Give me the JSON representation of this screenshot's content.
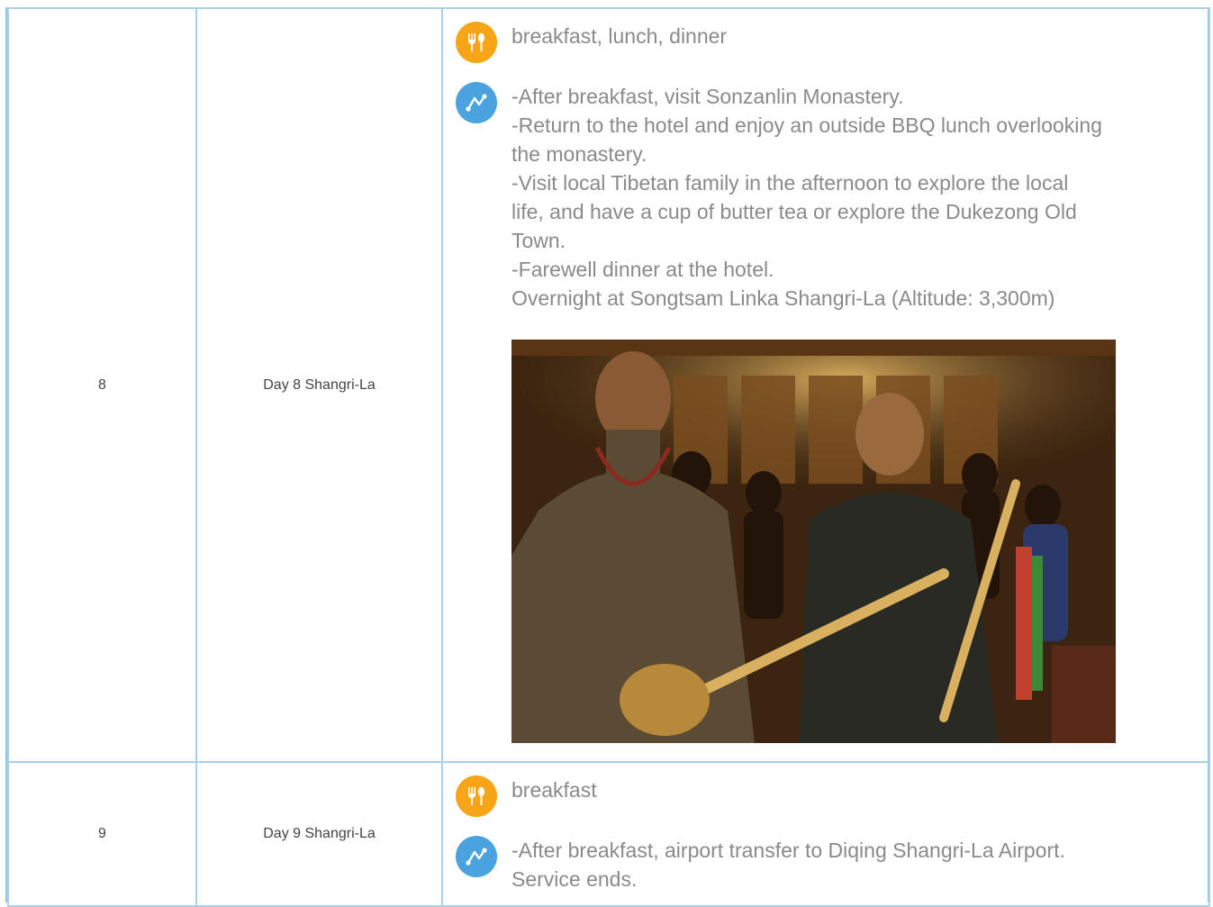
{
  "rows": [
    {
      "number": "8",
      "day": "Day 8 Shangri-La",
      "meals": "breakfast, lunch, dinner",
      "activities": [
        "-After breakfast, visit Sonzanlin Monastery.",
        "-Return to the hotel and enjoy an outside BBQ lunch overlooking the monastery.",
        "-Visit local Tibetan family in the afternoon to explore the local life, and have a cup of butter tea or explore the Dukezong Old Town.",
        "-Farewell dinner at the hotel.",
        "Overnight at Songtsam Linka Shangri-La (Altitude: 3,300m)"
      ]
    },
    {
      "number": "9",
      "day": "Day 9 Shangri-La",
      "meals": "breakfast",
      "activities": [
        "-After breakfast, airport transfer to Diqing Shangri-La Airport.",
        "Service ends."
      ]
    }
  ],
  "icons": {
    "meal": "fork-spoon-icon",
    "route": "route-icon"
  },
  "colors": {
    "border": "#a9d2e8",
    "meal_icon_bg": "#f7a416",
    "route_icon_bg": "#4aa3df",
    "text_gray": "#8a8a8a"
  }
}
